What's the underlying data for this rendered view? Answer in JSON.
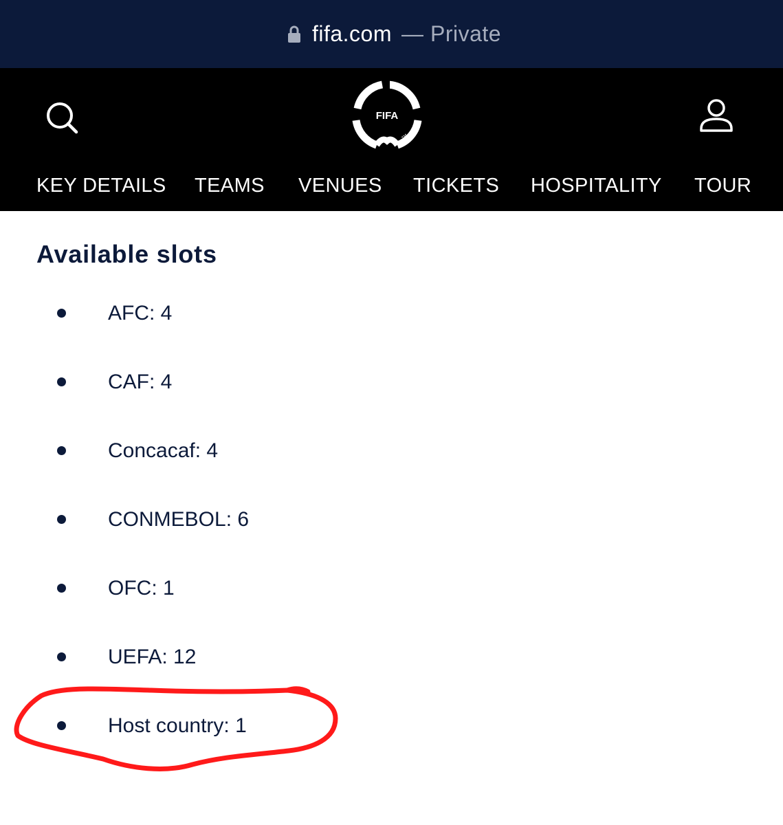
{
  "browser": {
    "domain": "fifa.com",
    "separator": "—",
    "mode": "Private",
    "lock_icon": "lock-icon"
  },
  "header": {
    "background": "#000000",
    "search_icon": "search-icon",
    "account_icon": "user-icon",
    "logo_text": "FIFA",
    "nav": [
      "KEY DETAILS",
      "TEAMS",
      "VENUES",
      "TICKETS",
      "HOSPITALITY",
      "TOUR"
    ]
  },
  "main": {
    "title": "Available slots",
    "slots": [
      "AFC: 4",
      "CAF: 4",
      "Concacaf: 4",
      "CONMEBOL: 6",
      "OFC: 1",
      "UEFA: 12",
      "Host country: 1"
    ]
  },
  "colors": {
    "navy": "#0c1a3a",
    "muted": "#a6adbd",
    "annotation_red": "#ff1a1a"
  }
}
